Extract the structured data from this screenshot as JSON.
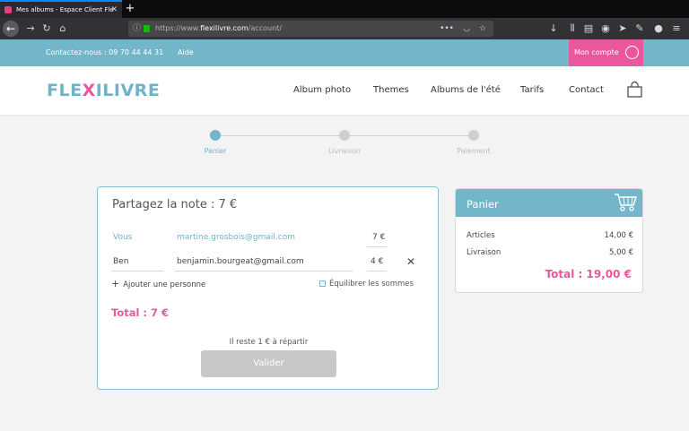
{
  "browser": {
    "tab_title": "Mes albums - Espace Client Fle",
    "tab_close": "✕",
    "new_tab": "+",
    "url_prefix": "https://www.",
    "url_domain": "flexilivre.com",
    "url_path": "/account/"
  },
  "topbar": {
    "contact": "Contactez-nous : 09 70 44 44 31",
    "help": "Aide",
    "account": "Mon compte"
  },
  "header": {
    "logo_pre": "FLE",
    "logo_x": "X",
    "logo_post": "ILIVRE",
    "nav": [
      "Album photo",
      "Themes",
      "Albums de l'été",
      "Tarifs",
      "Contact"
    ]
  },
  "steps": [
    {
      "label": "Panier",
      "active": true
    },
    {
      "label": "Livraison",
      "active": false
    },
    {
      "label": "Paiement",
      "active": false
    }
  ],
  "split": {
    "title": "Partagez la note : 7 €",
    "rows": [
      {
        "name": "Vous",
        "email": "martine.grosbois@gmail.com",
        "amount": "7 €"
      },
      {
        "name": "Ben",
        "email": "benjamin.bourgeat@gmail.com",
        "amount": "4 €"
      }
    ],
    "remove": "✕",
    "add_person": "Ajouter une personne",
    "equalize": "Équilibrer les sommes",
    "total": "Total : 7 €",
    "remaining": "Il reste 1 € à répartir",
    "validate": "Valider"
  },
  "cart": {
    "title": "Panier",
    "articles_label": "Articles",
    "articles_value": "14,00 €",
    "shipping_label": "Livraison",
    "shipping_value": "5,00 €",
    "total": "Total : 19,00 €"
  },
  "colors": {
    "brand_blue": "#74b6c9",
    "brand_pink": "#e8589a",
    "button_disabled": "#c8c8c8"
  }
}
